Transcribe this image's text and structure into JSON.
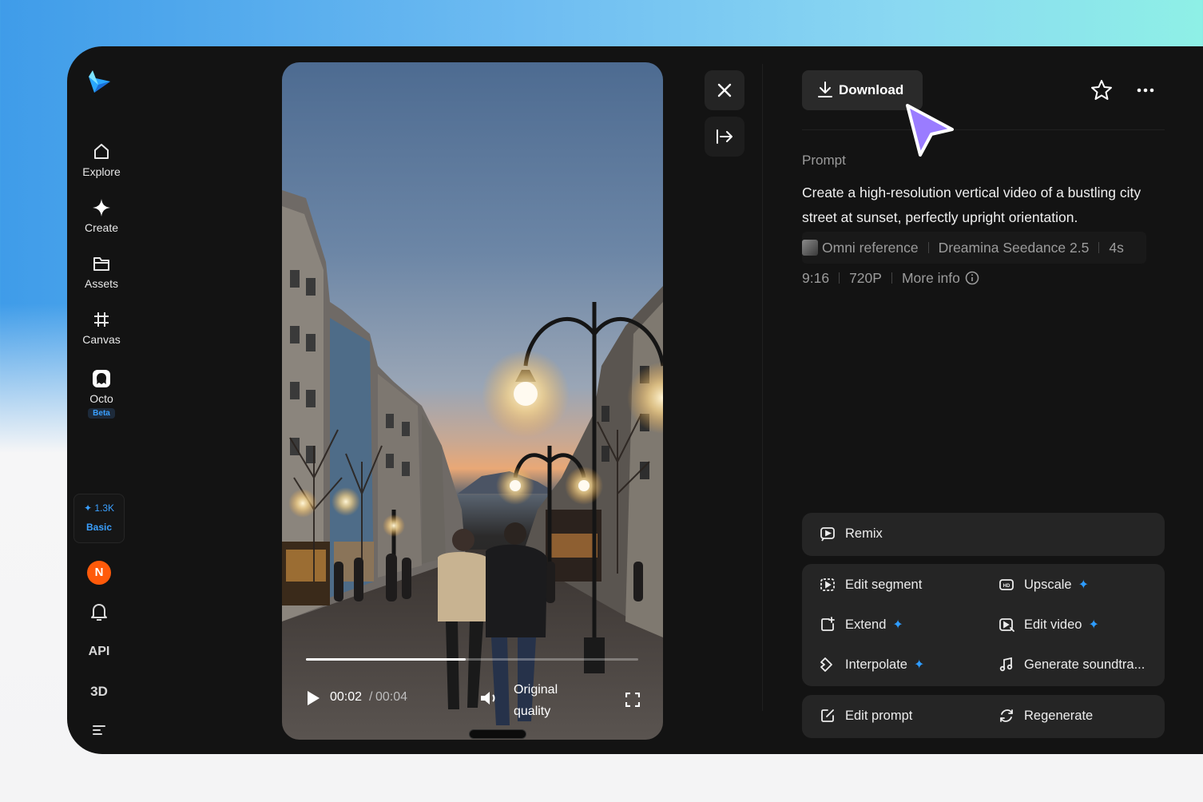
{
  "sidebar": {
    "items": [
      {
        "label": "Explore",
        "icon": "home-icon"
      },
      {
        "label": "Create",
        "icon": "sparkle-icon"
      },
      {
        "label": "Assets",
        "icon": "folder-icon"
      },
      {
        "label": "Canvas",
        "icon": "canvas-icon"
      },
      {
        "label": "Octo",
        "icon": "octo-icon",
        "badge": "Beta"
      }
    ],
    "credits": {
      "amount": "1.3K",
      "plan": "Basic"
    },
    "avatar_initial": "N",
    "api_label": "API",
    "threed_label": "3D"
  },
  "player": {
    "current_time": "00:02",
    "separator": "/",
    "total_time": "00:04",
    "quality_line1": "Original",
    "quality_line2": "quality",
    "progress": 0.48
  },
  "panel": {
    "download_label": "Download",
    "prompt_label": "Prompt",
    "prompt_text": "Create a high-resolution vertical video of a bustling city street at sunset, perfectly upright orientation.",
    "reference": "Omni reference",
    "model": "Dreamina Seedance 2.5",
    "duration": "4s",
    "ratio": "9:16",
    "resolution": "720P",
    "more_info": "More info"
  },
  "actions": {
    "remix": "Remix",
    "edit_segment": "Edit segment",
    "upscale": "Upscale",
    "extend": "Extend",
    "edit_video": "Edit video",
    "interpolate": "Interpolate",
    "generate_soundtrack": "Generate soundtra...",
    "edit_prompt": "Edit prompt",
    "regenerate": "Regenerate"
  },
  "colors": {
    "accent_blue": "#2e9cff",
    "cursor_purple": "#9a7cff",
    "avatar_orange": "#ff5a0a"
  }
}
